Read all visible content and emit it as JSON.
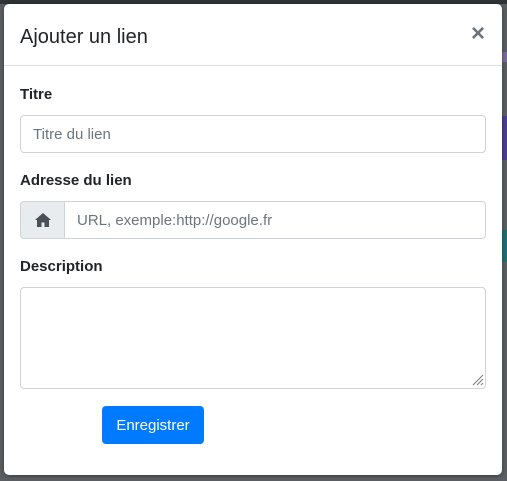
{
  "modal": {
    "title": "Ajouter un lien",
    "close_glyph": "×"
  },
  "form": {
    "title_label": "Titre",
    "title_placeholder": "Titre du lien",
    "title_value": "",
    "url_label": "Adresse du lien",
    "url_icon": "home-icon",
    "url_placeholder": "URL, exemple:http://google.fr",
    "url_value": "",
    "description_label": "Description",
    "description_value": "",
    "save_label": "Enregistrer"
  },
  "colors": {
    "primary": "#007bff",
    "border": "#ced4da",
    "addon_bg": "#e9ecef",
    "text": "#212529",
    "placeholder": "#6c757d"
  }
}
